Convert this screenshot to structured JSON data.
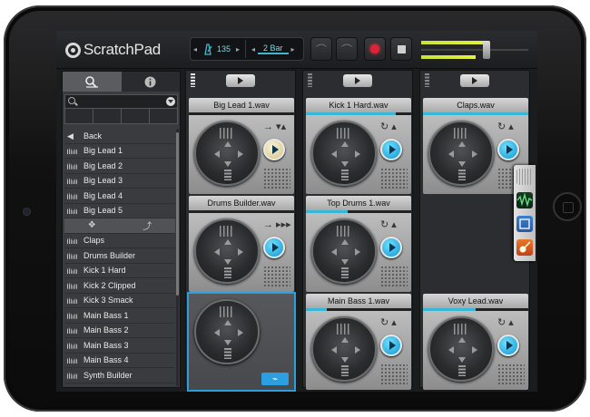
{
  "app": {
    "name": "ScratchPad"
  },
  "transport": {
    "tempo": "135",
    "bars": "2 Bar"
  },
  "browser": {
    "tabs": [
      {
        "icon": "search-browse-icon"
      },
      {
        "icon": "info-icon"
      }
    ],
    "items": [
      {
        "label": "Back",
        "type": "back"
      },
      {
        "label": "Big Lead 1"
      },
      {
        "label": "Big Lead 2"
      },
      {
        "label": "Big Lead 3"
      },
      {
        "label": "Big Lead 4"
      },
      {
        "label": "Big Lead 5"
      },
      {
        "label": "",
        "type": "tools"
      },
      {
        "label": "Claps"
      },
      {
        "label": "Drums Builder"
      },
      {
        "label": "Kick 1 Hard"
      },
      {
        "label": "Kick 2 Clipped"
      },
      {
        "label": "Kick 3 Smack"
      },
      {
        "label": "Main Bass 1"
      },
      {
        "label": "Main Bass 2"
      },
      {
        "label": "Main Bass 3"
      },
      {
        "label": "Main Bass 4"
      },
      {
        "label": "Synth Builder"
      }
    ]
  },
  "columns": [
    {
      "slots": [
        {
          "title": "Big Lead 1.wav",
          "mode": "→ ▾▴",
          "state": "paused",
          "progress": 0
        },
        {
          "title": "Drums Builder.wav",
          "mode": "→ ▸▸▸",
          "state": "playing",
          "progress": 0
        },
        {
          "title": "",
          "state": "empty-selected"
        }
      ]
    },
    {
      "slots": [
        {
          "title": "Kick 1 Hard.wav",
          "mode": "↻ ▴",
          "state": "playing",
          "progress": 0.85
        },
        {
          "title": "Top Drums 1.wav",
          "mode": "↻ ▴",
          "state": "playing",
          "progress": 0.4
        },
        {
          "title": "Main Bass 1.wav",
          "mode": "↻ ▴",
          "state": "playing",
          "progress": 0.2
        }
      ]
    },
    {
      "slots": [
        {
          "title": "Claps.wav",
          "mode": "↻ ▴",
          "state": "playing",
          "progress": 1.0
        },
        {
          "title": "",
          "state": "empty"
        },
        {
          "title": "Voxy Lead.wav",
          "mode": "↻ ▴",
          "state": "playing",
          "progress": 0.5
        }
      ]
    }
  ],
  "colors": {
    "accent": "#36b8d6",
    "record": "#e0213a",
    "meter": "#c9e23a",
    "selection": "#2c9fe0"
  }
}
